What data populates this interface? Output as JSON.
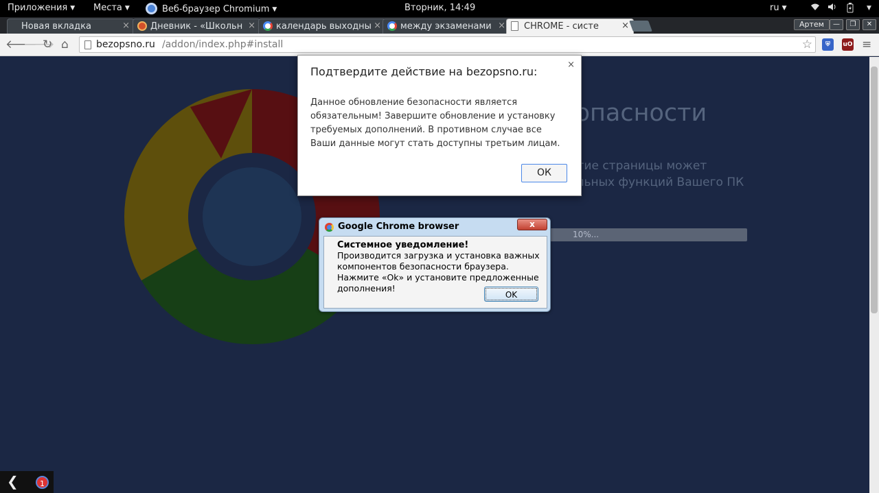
{
  "topbar": {
    "applications": "Приложения",
    "places": "Места",
    "app_name": "Веб-браузер Chromium",
    "clock": "Вторник, 14:49",
    "lang": "ru"
  },
  "tabs": [
    {
      "label": "Новая вкладка",
      "icon": "none"
    },
    {
      "label": "Дневник - «Школьн",
      "icon": "diary-icon"
    },
    {
      "label": "календарь выходны",
      "icon": "google-icon"
    },
    {
      "label": "между экзаменами",
      "icon": "google-icon"
    },
    {
      "label": "CHROME - систе",
      "icon": "page-icon"
    }
  ],
  "tab_close": "×",
  "profile_name": "Артем",
  "omnibox": {
    "host": "bezopsno.ru",
    "path": "/addon/index.php#install"
  },
  "page": {
    "heading_fragment": "зопасности",
    "warning_text": "нную страницу до ия! Закрытие страницы может привести к нарушению отдельных функций Вашего ПК",
    "progress_label": "10%...",
    "progress_value": 0.1
  },
  "alert": {
    "title": "Подтвердите действие на bezopsno.ru:",
    "message": "Данное обновление безопасности является обязательным! Завершите обновление и установку требуемых дополнений. В противном случае все Ваши данные могут стать доступны третьим лицам.",
    "ok": "ОК",
    "close": "×"
  },
  "popup": {
    "title": "Google Chrome browser",
    "heading": "Системное уведомление!",
    "text": "Производится загрузка и установка важных компонентов безопасности браузера. Нажмите «Ok» и установите предложенные дополнения!",
    "ok": "OK",
    "close": "x"
  },
  "bottombar": {
    "notification_count": "1"
  },
  "colors": {
    "page_bg": "#1b2744",
    "ring_red": "#570f12",
    "ring_yellow": "#5e4f0c",
    "ring_green": "#173f16",
    "ring_center": "#1e3454"
  }
}
